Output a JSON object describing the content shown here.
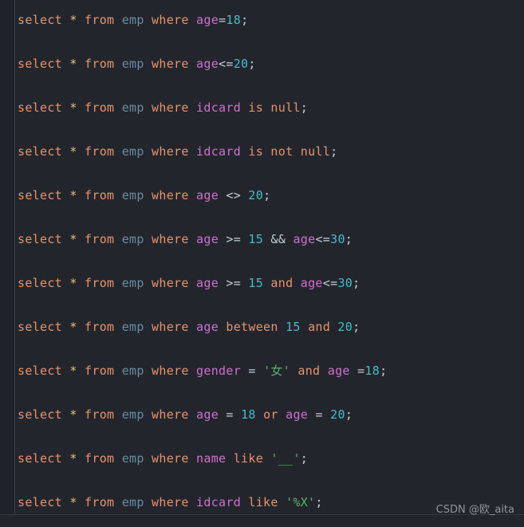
{
  "editor": {
    "background_color": "#22262c",
    "gutter_color": "#1f2329",
    "gutter_border_color": "#3a4048",
    "rule_color": "#33383f"
  },
  "theme": {
    "keyword": "#e8926d",
    "star": "#e5c07b",
    "table": "#6b8ba4",
    "column": "#d06fce",
    "number": "#3fbecb",
    "string": "#5ab06a",
    "operator": "#c5cdd6",
    "punctuation": "#c5cdd6"
  },
  "watermark": {
    "text": "CSDN @欧_aita"
  },
  "code": {
    "language": "sql",
    "plain_text": [
      "select * from emp where age=18;",
      "",
      "select * from emp where age<=20;",
      "",
      "select * from emp where idcard is null;",
      "",
      "select * from emp where idcard is not null;",
      "",
      "select * from emp where age <> 20;",
      "",
      "select * from emp where age >= 15 && age<=30;",
      "",
      "select * from emp where age >= 15 and age<=30;",
      "",
      "select * from emp where age between 15 and 20;",
      "",
      "select * from emp where gender = '女' and age =18;",
      "",
      "select * from emp where age = 18 or age = 20;",
      "",
      "select * from emp where name like '__';",
      "",
      "select * from emp where idcard like '%X';"
    ],
    "lines": [
      {
        "blank": false,
        "tokens": [
          {
            "t": "select",
            "c": "keyword"
          },
          {
            "t": " ",
            "c": "plain"
          },
          {
            "t": "*",
            "c": "star"
          },
          {
            "t": " ",
            "c": "plain"
          },
          {
            "t": "from",
            "c": "keyword"
          },
          {
            "t": " ",
            "c": "plain"
          },
          {
            "t": "emp",
            "c": "table"
          },
          {
            "t": " ",
            "c": "plain"
          },
          {
            "t": "where",
            "c": "keyword"
          },
          {
            "t": " ",
            "c": "plain"
          },
          {
            "t": "age",
            "c": "column"
          },
          {
            "t": "=",
            "c": "operator"
          },
          {
            "t": "18",
            "c": "number"
          },
          {
            "t": ";",
            "c": "punct"
          }
        ]
      },
      {
        "blank": true,
        "tokens": []
      },
      {
        "blank": false,
        "tokens": [
          {
            "t": "select",
            "c": "keyword"
          },
          {
            "t": " ",
            "c": "plain"
          },
          {
            "t": "*",
            "c": "star"
          },
          {
            "t": " ",
            "c": "plain"
          },
          {
            "t": "from",
            "c": "keyword"
          },
          {
            "t": " ",
            "c": "plain"
          },
          {
            "t": "emp",
            "c": "table"
          },
          {
            "t": " ",
            "c": "plain"
          },
          {
            "t": "where",
            "c": "keyword"
          },
          {
            "t": " ",
            "c": "plain"
          },
          {
            "t": "age",
            "c": "column"
          },
          {
            "t": "<=",
            "c": "operator"
          },
          {
            "t": "20",
            "c": "number"
          },
          {
            "t": ";",
            "c": "punct"
          }
        ]
      },
      {
        "blank": true,
        "tokens": []
      },
      {
        "blank": false,
        "tokens": [
          {
            "t": "select",
            "c": "keyword"
          },
          {
            "t": " ",
            "c": "plain"
          },
          {
            "t": "*",
            "c": "star"
          },
          {
            "t": " ",
            "c": "plain"
          },
          {
            "t": "from",
            "c": "keyword"
          },
          {
            "t": " ",
            "c": "plain"
          },
          {
            "t": "emp",
            "c": "table"
          },
          {
            "t": " ",
            "c": "plain"
          },
          {
            "t": "where",
            "c": "keyword"
          },
          {
            "t": " ",
            "c": "plain"
          },
          {
            "t": "idcard",
            "c": "column"
          },
          {
            "t": " ",
            "c": "plain"
          },
          {
            "t": "is",
            "c": "keyword"
          },
          {
            "t": " ",
            "c": "plain"
          },
          {
            "t": "null",
            "c": "keyword"
          },
          {
            "t": ";",
            "c": "punct"
          }
        ]
      },
      {
        "blank": true,
        "tokens": []
      },
      {
        "blank": false,
        "tokens": [
          {
            "t": "select",
            "c": "keyword"
          },
          {
            "t": " ",
            "c": "plain"
          },
          {
            "t": "*",
            "c": "star"
          },
          {
            "t": " ",
            "c": "plain"
          },
          {
            "t": "from",
            "c": "keyword"
          },
          {
            "t": " ",
            "c": "plain"
          },
          {
            "t": "emp",
            "c": "table"
          },
          {
            "t": " ",
            "c": "plain"
          },
          {
            "t": "where",
            "c": "keyword"
          },
          {
            "t": " ",
            "c": "plain"
          },
          {
            "t": "idcard",
            "c": "column"
          },
          {
            "t": " ",
            "c": "plain"
          },
          {
            "t": "is",
            "c": "keyword"
          },
          {
            "t": " ",
            "c": "plain"
          },
          {
            "t": "not",
            "c": "keyword"
          },
          {
            "t": " ",
            "c": "plain"
          },
          {
            "t": "null",
            "c": "keyword"
          },
          {
            "t": ";",
            "c": "punct"
          }
        ]
      },
      {
        "blank": true,
        "tokens": []
      },
      {
        "blank": false,
        "tokens": [
          {
            "t": "select",
            "c": "keyword"
          },
          {
            "t": " ",
            "c": "plain"
          },
          {
            "t": "*",
            "c": "star"
          },
          {
            "t": " ",
            "c": "plain"
          },
          {
            "t": "from",
            "c": "keyword"
          },
          {
            "t": " ",
            "c": "plain"
          },
          {
            "t": "emp",
            "c": "table"
          },
          {
            "t": " ",
            "c": "plain"
          },
          {
            "t": "where",
            "c": "keyword"
          },
          {
            "t": " ",
            "c": "plain"
          },
          {
            "t": "age",
            "c": "column"
          },
          {
            "t": " ",
            "c": "plain"
          },
          {
            "t": "<>",
            "c": "operator"
          },
          {
            "t": " ",
            "c": "plain"
          },
          {
            "t": "20",
            "c": "number"
          },
          {
            "t": ";",
            "c": "punct"
          }
        ]
      },
      {
        "blank": true,
        "tokens": []
      },
      {
        "blank": false,
        "tokens": [
          {
            "t": "select",
            "c": "keyword"
          },
          {
            "t": " ",
            "c": "plain"
          },
          {
            "t": "*",
            "c": "star"
          },
          {
            "t": " ",
            "c": "plain"
          },
          {
            "t": "from",
            "c": "keyword"
          },
          {
            "t": " ",
            "c": "plain"
          },
          {
            "t": "emp",
            "c": "table"
          },
          {
            "t": " ",
            "c": "plain"
          },
          {
            "t": "where",
            "c": "keyword"
          },
          {
            "t": " ",
            "c": "plain"
          },
          {
            "t": "age",
            "c": "column"
          },
          {
            "t": " ",
            "c": "plain"
          },
          {
            "t": ">=",
            "c": "operator"
          },
          {
            "t": " ",
            "c": "plain"
          },
          {
            "t": "15",
            "c": "number"
          },
          {
            "t": " ",
            "c": "plain"
          },
          {
            "t": "&&",
            "c": "operator"
          },
          {
            "t": " ",
            "c": "plain"
          },
          {
            "t": "age",
            "c": "column"
          },
          {
            "t": "<=",
            "c": "operator"
          },
          {
            "t": "30",
            "c": "number"
          },
          {
            "t": ";",
            "c": "punct"
          }
        ]
      },
      {
        "blank": true,
        "tokens": []
      },
      {
        "blank": false,
        "tokens": [
          {
            "t": "select",
            "c": "keyword"
          },
          {
            "t": " ",
            "c": "plain"
          },
          {
            "t": "*",
            "c": "star"
          },
          {
            "t": " ",
            "c": "plain"
          },
          {
            "t": "from",
            "c": "keyword"
          },
          {
            "t": " ",
            "c": "plain"
          },
          {
            "t": "emp",
            "c": "table"
          },
          {
            "t": " ",
            "c": "plain"
          },
          {
            "t": "where",
            "c": "keyword"
          },
          {
            "t": " ",
            "c": "plain"
          },
          {
            "t": "age",
            "c": "column"
          },
          {
            "t": " ",
            "c": "plain"
          },
          {
            "t": ">=",
            "c": "operator"
          },
          {
            "t": " ",
            "c": "plain"
          },
          {
            "t": "15",
            "c": "number"
          },
          {
            "t": " ",
            "c": "plain"
          },
          {
            "t": "and",
            "c": "keyword"
          },
          {
            "t": " ",
            "c": "plain"
          },
          {
            "t": "age",
            "c": "column"
          },
          {
            "t": "<=",
            "c": "operator"
          },
          {
            "t": "30",
            "c": "number"
          },
          {
            "t": ";",
            "c": "punct"
          }
        ]
      },
      {
        "blank": true,
        "tokens": []
      },
      {
        "blank": false,
        "tokens": [
          {
            "t": "select",
            "c": "keyword"
          },
          {
            "t": " ",
            "c": "plain"
          },
          {
            "t": "*",
            "c": "star"
          },
          {
            "t": " ",
            "c": "plain"
          },
          {
            "t": "from",
            "c": "keyword"
          },
          {
            "t": " ",
            "c": "plain"
          },
          {
            "t": "emp",
            "c": "table"
          },
          {
            "t": " ",
            "c": "plain"
          },
          {
            "t": "where",
            "c": "keyword"
          },
          {
            "t": " ",
            "c": "plain"
          },
          {
            "t": "age",
            "c": "column"
          },
          {
            "t": " ",
            "c": "plain"
          },
          {
            "t": "between",
            "c": "keyword"
          },
          {
            "t": " ",
            "c": "plain"
          },
          {
            "t": "15",
            "c": "number"
          },
          {
            "t": " ",
            "c": "plain"
          },
          {
            "t": "and",
            "c": "keyword"
          },
          {
            "t": " ",
            "c": "plain"
          },
          {
            "t": "20",
            "c": "number"
          },
          {
            "t": ";",
            "c": "punct"
          }
        ]
      },
      {
        "blank": true,
        "tokens": []
      },
      {
        "blank": false,
        "tokens": [
          {
            "t": "select",
            "c": "keyword"
          },
          {
            "t": " ",
            "c": "plain"
          },
          {
            "t": "*",
            "c": "star"
          },
          {
            "t": " ",
            "c": "plain"
          },
          {
            "t": "from",
            "c": "keyword"
          },
          {
            "t": " ",
            "c": "plain"
          },
          {
            "t": "emp",
            "c": "table"
          },
          {
            "t": " ",
            "c": "plain"
          },
          {
            "t": "where",
            "c": "keyword"
          },
          {
            "t": " ",
            "c": "plain"
          },
          {
            "t": "gender",
            "c": "column"
          },
          {
            "t": " ",
            "c": "plain"
          },
          {
            "t": "=",
            "c": "operator"
          },
          {
            "t": " ",
            "c": "plain"
          },
          {
            "t": "'女'",
            "c": "string"
          },
          {
            "t": " ",
            "c": "plain"
          },
          {
            "t": "and",
            "c": "keyword"
          },
          {
            "t": " ",
            "c": "plain"
          },
          {
            "t": "age",
            "c": "column"
          },
          {
            "t": " ",
            "c": "plain"
          },
          {
            "t": "=",
            "c": "operator"
          },
          {
            "t": "18",
            "c": "number"
          },
          {
            "t": ";",
            "c": "punct"
          }
        ]
      },
      {
        "blank": true,
        "tokens": []
      },
      {
        "blank": false,
        "tokens": [
          {
            "t": "select",
            "c": "keyword"
          },
          {
            "t": " ",
            "c": "plain"
          },
          {
            "t": "*",
            "c": "star"
          },
          {
            "t": " ",
            "c": "plain"
          },
          {
            "t": "from",
            "c": "keyword"
          },
          {
            "t": " ",
            "c": "plain"
          },
          {
            "t": "emp",
            "c": "table"
          },
          {
            "t": " ",
            "c": "plain"
          },
          {
            "t": "where",
            "c": "keyword"
          },
          {
            "t": " ",
            "c": "plain"
          },
          {
            "t": "age",
            "c": "column"
          },
          {
            "t": " ",
            "c": "plain"
          },
          {
            "t": "=",
            "c": "operator"
          },
          {
            "t": " ",
            "c": "plain"
          },
          {
            "t": "18",
            "c": "number"
          },
          {
            "t": " ",
            "c": "plain"
          },
          {
            "t": "or",
            "c": "keyword"
          },
          {
            "t": " ",
            "c": "plain"
          },
          {
            "t": "age",
            "c": "column"
          },
          {
            "t": " ",
            "c": "plain"
          },
          {
            "t": "=",
            "c": "operator"
          },
          {
            "t": " ",
            "c": "plain"
          },
          {
            "t": "20",
            "c": "number"
          },
          {
            "t": ";",
            "c": "punct"
          }
        ]
      },
      {
        "blank": true,
        "tokens": []
      },
      {
        "blank": false,
        "tokens": [
          {
            "t": "select",
            "c": "keyword"
          },
          {
            "t": " ",
            "c": "plain"
          },
          {
            "t": "*",
            "c": "star"
          },
          {
            "t": " ",
            "c": "plain"
          },
          {
            "t": "from",
            "c": "keyword"
          },
          {
            "t": " ",
            "c": "plain"
          },
          {
            "t": "emp",
            "c": "table"
          },
          {
            "t": " ",
            "c": "plain"
          },
          {
            "t": "where",
            "c": "keyword"
          },
          {
            "t": " ",
            "c": "plain"
          },
          {
            "t": "name",
            "c": "column"
          },
          {
            "t": " ",
            "c": "plain"
          },
          {
            "t": "like",
            "c": "keyword"
          },
          {
            "t": " ",
            "c": "plain"
          },
          {
            "t": "'__'",
            "c": "string"
          },
          {
            "t": ";",
            "c": "punct"
          }
        ]
      },
      {
        "blank": true,
        "tokens": []
      },
      {
        "blank": false,
        "tokens": [
          {
            "t": "select",
            "c": "keyword"
          },
          {
            "t": " ",
            "c": "plain"
          },
          {
            "t": "*",
            "c": "star"
          },
          {
            "t": " ",
            "c": "plain"
          },
          {
            "t": "from",
            "c": "keyword"
          },
          {
            "t": " ",
            "c": "plain"
          },
          {
            "t": "emp",
            "c": "table"
          },
          {
            "t": " ",
            "c": "plain"
          },
          {
            "t": "where",
            "c": "keyword"
          },
          {
            "t": " ",
            "c": "plain"
          },
          {
            "t": "idcard",
            "c": "column"
          },
          {
            "t": " ",
            "c": "plain"
          },
          {
            "t": "like",
            "c": "keyword"
          },
          {
            "t": " ",
            "c": "plain"
          },
          {
            "t": "'%X'",
            "c": "string"
          },
          {
            "t": ";",
            "c": "punct"
          }
        ]
      }
    ]
  }
}
